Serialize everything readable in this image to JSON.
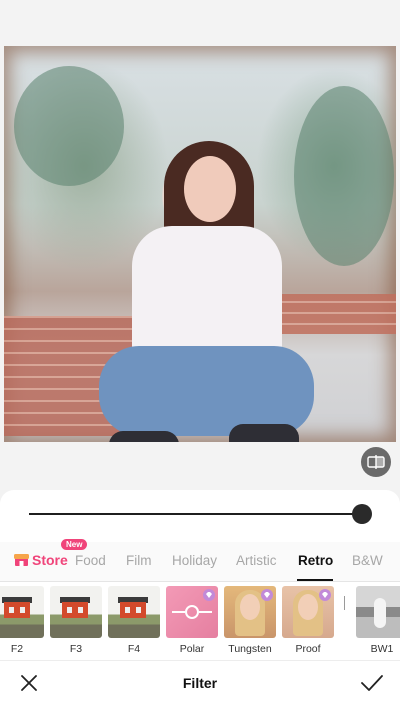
{
  "editor": {
    "compare_icon": "compare-split-icon",
    "filter_strength": 1.0
  },
  "categories": {
    "store_label": "Store",
    "new_badge": "New",
    "items": [
      "Food",
      "Film",
      "Holiday",
      "Artistic",
      "Retro",
      "B&W"
    ],
    "active": "Retro"
  },
  "filters": [
    {
      "label": "F2"
    },
    {
      "label": "F3"
    },
    {
      "label": "F4"
    },
    {
      "label": "Polar"
    },
    {
      "label": "Tungsten"
    },
    {
      "label": "Proof"
    },
    {
      "label": "BW1"
    }
  ],
  "bottom_bar": {
    "title": "Filter",
    "close_icon": "close-icon",
    "confirm_icon": "checkmark-icon"
  },
  "colors": {
    "accent": "#f0447a",
    "vip": "#c28ad8"
  }
}
